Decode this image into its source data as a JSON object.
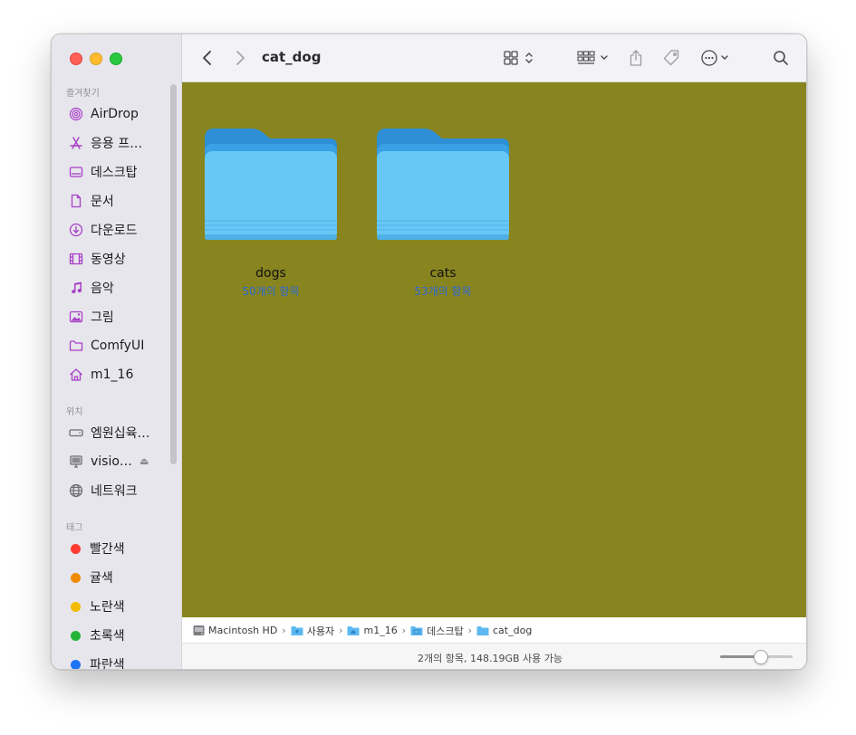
{
  "window": {
    "title": "cat_dog"
  },
  "sidebar": {
    "sections": [
      {
        "label": "즐겨찾기"
      },
      {
        "label": "위치"
      },
      {
        "label": "태그"
      }
    ],
    "favorites": [
      {
        "label": "AirDrop",
        "icon": "airdrop-icon"
      },
      {
        "label": "응용 프…",
        "icon": "applications-icon"
      },
      {
        "label": "데스크탑",
        "icon": "desktop-icon"
      },
      {
        "label": "문서",
        "icon": "document-icon"
      },
      {
        "label": "다운로드",
        "icon": "download-icon"
      },
      {
        "label": "동영상",
        "icon": "film-icon"
      },
      {
        "label": "음악",
        "icon": "music-icon"
      },
      {
        "label": "그림",
        "icon": "photo-icon"
      },
      {
        "label": "ComfyUI",
        "icon": "folder-icon"
      },
      {
        "label": "m1_16",
        "icon": "home-icon"
      }
    ],
    "locations": [
      {
        "label": "엠원십육…",
        "icon": "drive-icon"
      },
      {
        "label": "visio…",
        "icon": "computer-icon"
      },
      {
        "label": "네트워크",
        "icon": "network-icon"
      }
    ],
    "tags": [
      {
        "label": "빨간색",
        "color": "#fe3b30"
      },
      {
        "label": "귤색",
        "color": "#f08a00"
      },
      {
        "label": "노란색",
        "color": "#f2bb00"
      },
      {
        "label": "초록색",
        "color": "#25b43a"
      },
      {
        "label": "파란색",
        "color": "#1b74f5"
      }
    ]
  },
  "content": {
    "background": "#88841f",
    "items": [
      {
        "name": "dogs",
        "count": "50개의 항목"
      },
      {
        "name": "cats",
        "count": "53개의 항목"
      }
    ]
  },
  "pathbar": {
    "crumbs": [
      "Macintosh HD",
      "사용자",
      "m1_16",
      "데스크탑",
      "cat_dog"
    ]
  },
  "status": {
    "text": "2개의 항목, 148.19GB 사용 가능",
    "zoom_level": 0.55
  }
}
